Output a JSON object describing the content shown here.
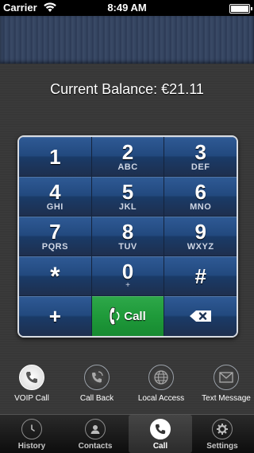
{
  "status_bar": {
    "carrier": "Carrier",
    "time": "8:49 AM"
  },
  "balance": {
    "text": "Current Balance: €21.11"
  },
  "keypad": {
    "rows": [
      [
        {
          "digit": "1",
          "letters": ""
        },
        {
          "digit": "2",
          "letters": "ABC"
        },
        {
          "digit": "3",
          "letters": "DEF"
        }
      ],
      [
        {
          "digit": "4",
          "letters": "GHI"
        },
        {
          "digit": "5",
          "letters": "JKL"
        },
        {
          "digit": "6",
          "letters": "MNO"
        }
      ],
      [
        {
          "digit": "7",
          "letters": "PQRS"
        },
        {
          "digit": "8",
          "letters": "TUV"
        },
        {
          "digit": "9",
          "letters": "WXYZ"
        }
      ],
      [
        {
          "digit": "*",
          "letters": ""
        },
        {
          "digit": "0",
          "letters": "+"
        },
        {
          "digit": "#",
          "letters": ""
        }
      ]
    ],
    "plus_label": "+",
    "call_label": "Call",
    "call_color": "#1f9a3a"
  },
  "actions": [
    {
      "label": "VOIP Call",
      "icon": "phone-icon",
      "active": true
    },
    {
      "label": "Call Back",
      "icon": "callback-icon",
      "active": false
    },
    {
      "label": "Local Access",
      "icon": "globe-icon",
      "active": false
    },
    {
      "label": "Text Message",
      "icon": "envelope-icon",
      "active": false
    }
  ],
  "tabs": [
    {
      "label": "History",
      "icon": "clock-icon",
      "active": false
    },
    {
      "label": "Contacts",
      "icon": "contacts-icon",
      "active": false
    },
    {
      "label": "Call",
      "icon": "phone-icon",
      "active": true
    },
    {
      "label": "Settings",
      "icon": "gear-icon",
      "active": false
    }
  ]
}
